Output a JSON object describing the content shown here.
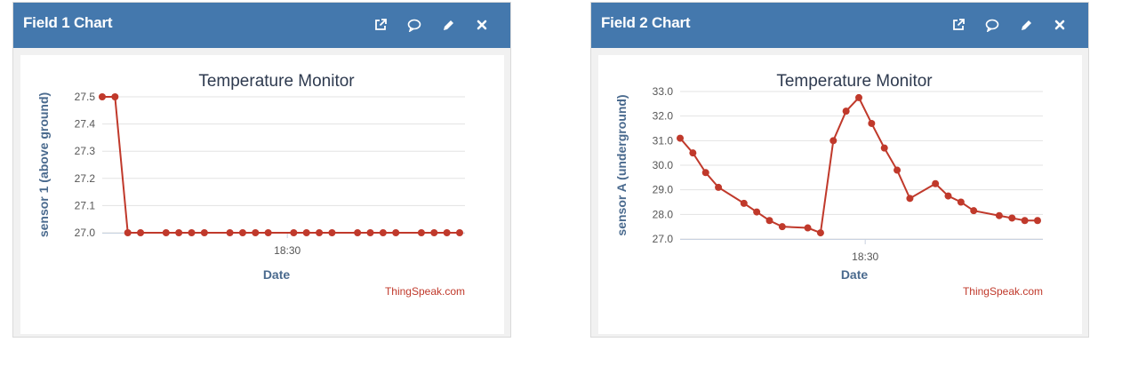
{
  "panels": [
    {
      "title": "Field 1 Chart",
      "tools": [
        {
          "icon": "external-link-icon"
        },
        {
          "icon": "comment-icon"
        },
        {
          "icon": "edit-pencil-icon"
        },
        {
          "icon": "close-icon"
        }
      ],
      "credit": "ThingSpeak.com"
    },
    {
      "title": "Field 2 Chart",
      "tools": [
        {
          "icon": "external-link-icon"
        },
        {
          "icon": "comment-icon"
        },
        {
          "icon": "edit-pencil-icon"
        },
        {
          "icon": "close-icon"
        }
      ],
      "credit": "ThingSpeak.com"
    }
  ],
  "colors": {
    "header": "#4478ad",
    "series": "#c0392b",
    "axis_label": "#4a6a8e",
    "grid": "#e3e3e3"
  },
  "chart_data": [
    {
      "type": "line",
      "title": "Temperature Monitor",
      "xlabel": "Date",
      "ylabel": "sensor 1 (above ground)",
      "ylim": [
        27.0,
        27.5
      ],
      "yticks": [
        "27.0",
        "27.1",
        "27.2",
        "27.3",
        "27.4",
        "27.5"
      ],
      "xticks": [
        {
          "x": 14.5,
          "label": "18:30"
        }
      ],
      "grid": true,
      "series": [
        {
          "x": [
            0,
            1,
            2,
            3,
            5,
            6,
            7,
            8,
            10,
            11,
            12,
            13,
            15,
            16,
            17,
            18,
            20,
            21,
            22,
            23,
            25,
            26,
            27,
            28
          ],
          "values": [
            27.5,
            27.5,
            27.0,
            27.0,
            27.0,
            27.0,
            27.0,
            27.0,
            27.0,
            27.0,
            27.0,
            27.0,
            27.0,
            27.0,
            27.0,
            27.0,
            27.0,
            27.0,
            27.0,
            27.0,
            27.0,
            27.0,
            27.0,
            27.0
          ]
        }
      ]
    },
    {
      "type": "line",
      "title": "Temperature Monitor",
      "xlabel": "Date",
      "ylabel": "sensor A (underground)",
      "ylim": [
        27.0,
        33.0
      ],
      "yticks": [
        "27.0",
        "28.0",
        "29.0",
        "30.0",
        "31.0",
        "32.0",
        "33.0"
      ],
      "xticks": [
        {
          "x": 14.5,
          "label": "18:30"
        }
      ],
      "grid": true,
      "series": [
        {
          "x": [
            0,
            1,
            2,
            3,
            5,
            6,
            7,
            8,
            10,
            11,
            12,
            13,
            14,
            15,
            16,
            17,
            18,
            20,
            21,
            22,
            23,
            25,
            26,
            27,
            28
          ],
          "values": [
            31.1,
            30.5,
            29.7,
            29.1,
            28.45,
            28.1,
            27.75,
            27.5,
            27.45,
            27.25,
            31.0,
            32.2,
            32.75,
            31.7,
            30.7,
            29.8,
            28.65,
            29.25,
            28.75,
            28.5,
            28.15,
            27.95,
            27.85,
            27.75,
            27.75
          ]
        }
      ]
    }
  ]
}
